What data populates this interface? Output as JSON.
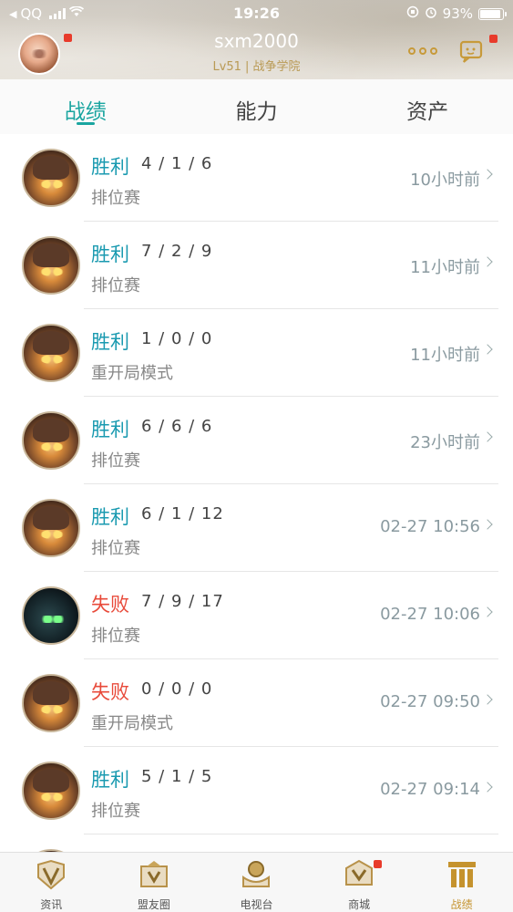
{
  "status_bar": {
    "carrier": "QQ",
    "time": "19:26",
    "battery": "93%",
    "battery_level": 0.93
  },
  "header": {
    "username": "sxm2000",
    "level_info": "Lv51 | 战争学院"
  },
  "tabs": [
    {
      "label": "战绩",
      "active": true
    },
    {
      "label": "能力",
      "active": false
    },
    {
      "label": "资产",
      "active": false
    }
  ],
  "matches": [
    {
      "result": "胜利",
      "outcome": "win",
      "kda": "4 / 1 / 6",
      "mode": "排位赛",
      "time": "10小时前",
      "hero": "teemo-ish"
    },
    {
      "result": "胜利",
      "outcome": "win",
      "kda": "7 / 2 / 9",
      "mode": "排位赛",
      "time": "11小时前",
      "hero": "teemo-ish"
    },
    {
      "result": "胜利",
      "outcome": "win",
      "kda": "1 / 0 / 0",
      "mode": "重开局模式",
      "time": "11小时前",
      "hero": "teemo-ish"
    },
    {
      "result": "胜利",
      "outcome": "win",
      "kda": "6 / 6 / 6",
      "mode": "排位赛",
      "time": "23小时前",
      "hero": "teemo-ish"
    },
    {
      "result": "胜利",
      "outcome": "win",
      "kda": "6 / 1 / 12",
      "mode": "排位赛",
      "time": "02-27 10:56",
      "hero": "teemo-ish"
    },
    {
      "result": "失败",
      "outcome": "lose",
      "kda": "7 / 9 / 17",
      "mode": "排位赛",
      "time": "02-27 10:06",
      "hero": "dark"
    },
    {
      "result": "失败",
      "outcome": "lose",
      "kda": "0 / 0 / 0",
      "mode": "重开局模式",
      "time": "02-27 09:50",
      "hero": "teemo-ish"
    },
    {
      "result": "胜利",
      "outcome": "win",
      "kda": "5 / 1 / 5",
      "mode": "排位赛",
      "time": "02-27 09:14",
      "hero": "teemo-ish"
    }
  ],
  "bottom_nav": [
    {
      "label": "资讯",
      "icon": "news-icon",
      "active": false,
      "badge": false
    },
    {
      "label": "盟友圈",
      "icon": "friends-circle-icon",
      "active": false,
      "badge": false
    },
    {
      "label": "电视台",
      "icon": "tv-icon",
      "active": false,
      "badge": false
    },
    {
      "label": "商城",
      "icon": "store-icon",
      "active": false,
      "badge": true
    },
    {
      "label": "战绩",
      "icon": "record-icon",
      "active": true,
      "badge": false
    }
  ],
  "colors": {
    "accent": "#1aa5a0",
    "win": "#1a9ab0",
    "lose": "#e84a3a",
    "gold": "#c5932e"
  }
}
